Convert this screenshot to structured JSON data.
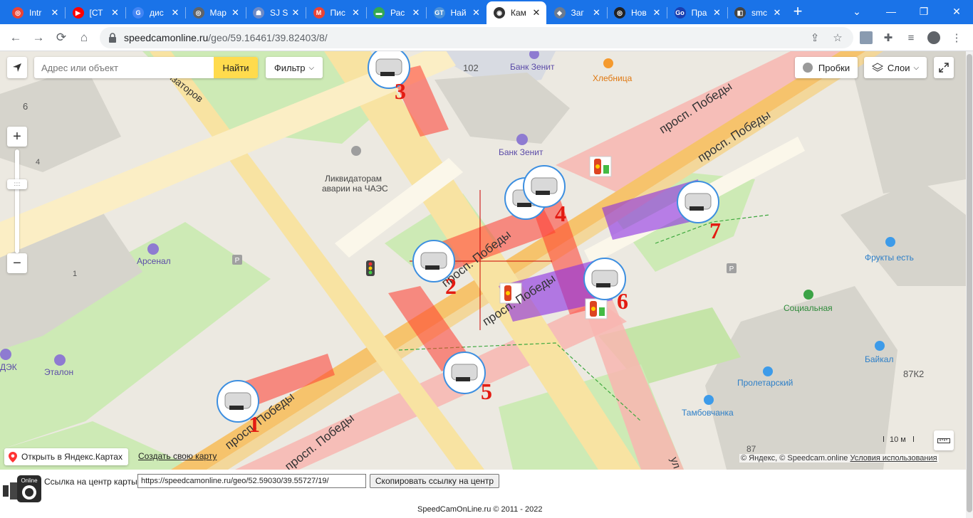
{
  "browser": {
    "tabs": [
      {
        "label": "Intr",
        "color": "#ea4335",
        "glyph": "◎"
      },
      {
        "label": "[СТ",
        "color": "#ff0000",
        "glyph": "▶"
      },
      {
        "label": "дис",
        "color": "#4285f4",
        "glyph": "G"
      },
      {
        "label": "Мар",
        "color": "#5f6368",
        "glyph": "◎"
      },
      {
        "label": "SJ S",
        "color": "#6d8ac7",
        "glyph": "☗"
      },
      {
        "label": "Пис",
        "color": "#ea4335",
        "glyph": "M"
      },
      {
        "label": "Рас",
        "color": "#34a853",
        "glyph": "▬"
      },
      {
        "label": "Най",
        "color": "#4a90d9",
        "glyph": "GT"
      },
      {
        "label": "Кам",
        "color": "#333333",
        "glyph": "◉",
        "active": true
      },
      {
        "label": "Заг",
        "color": "#6b7a8f",
        "glyph": "◆"
      },
      {
        "label": "Нов",
        "color": "#202124",
        "glyph": "◎"
      },
      {
        "label": "Пра",
        "color": "#1a3fb0",
        "glyph": "Go"
      },
      {
        "label": "smc",
        "color": "#444444",
        "glyph": "◧"
      }
    ],
    "url_host": "speedcamonline.ru",
    "url_path": "/geo/59.16461/39.82403/8/"
  },
  "map": {
    "search_placeholder": "Адрес или объект",
    "search_button": "Найти",
    "filter_button": "Фильтр",
    "traffic_button": "Пробки",
    "layers_button": "Слои",
    "zoom_in": "+",
    "zoom_out": "−",
    "open_yandex": "Открыть в Яндекс.Картах",
    "create_map": "Создать свою карту",
    "copyright": "© Яндекс, © Speedcam.online",
    "terms": "Условия использования",
    "scale": "10 м",
    "labels": {
      "street_nizatorov": "низаторов",
      "building_102": "102",
      "bank_zenit_1": "Банк Зенит",
      "hlebnica": "Хлебница",
      "bank_zenit_2": "Банк Зенит",
      "monument_1": "Ликвидаторам",
      "monument_2": "аварии на ЧАЭС",
      "num_6": "6",
      "num_4": "4",
      "arsenal": "Арсенал",
      "entrance_1": "1",
      "deck": "ДЭК",
      "etalon": "Эталон",
      "frukty": "Фрукты есть",
      "socialnaya": "Социальная",
      "baikal": "Байкал",
      "building_87k2": "87К2",
      "proletarsky": "Пролетарский",
      "tambovchanka": "Тамбовчанка",
      "building_87": "87",
      "street_pobedy_1": "просп. Победы",
      "street_pobedy_2": "просп. Победы",
      "street_pobedy_3": "просп. Победы",
      "street_pobedy_4": "просп. Победы",
      "street_pobedy_5": "просп. Победы",
      "street_pobedy_6": "просп. Победы",
      "street_u": "ул"
    },
    "cameras": [
      "1",
      "2",
      "3",
      "4",
      "5",
      "6",
      "7"
    ],
    "colors": {
      "zone_red": "#ff3b30",
      "zone_purple": "#8a2be2",
      "camera_number": "#e31b12",
      "road_main": "#f9c96b",
      "grass": "#cdeab5"
    }
  },
  "footer": {
    "link_label": "Ссылка на центр карты:",
    "link_value": "https://speedcamonline.ru/geo/52.59030/39.55727/19/",
    "copy_button": "Скопировать ссылку на центр",
    "copyright": "SpeedCamOnLine.ru © 2011 - 2022",
    "logo_text": "Online"
  }
}
